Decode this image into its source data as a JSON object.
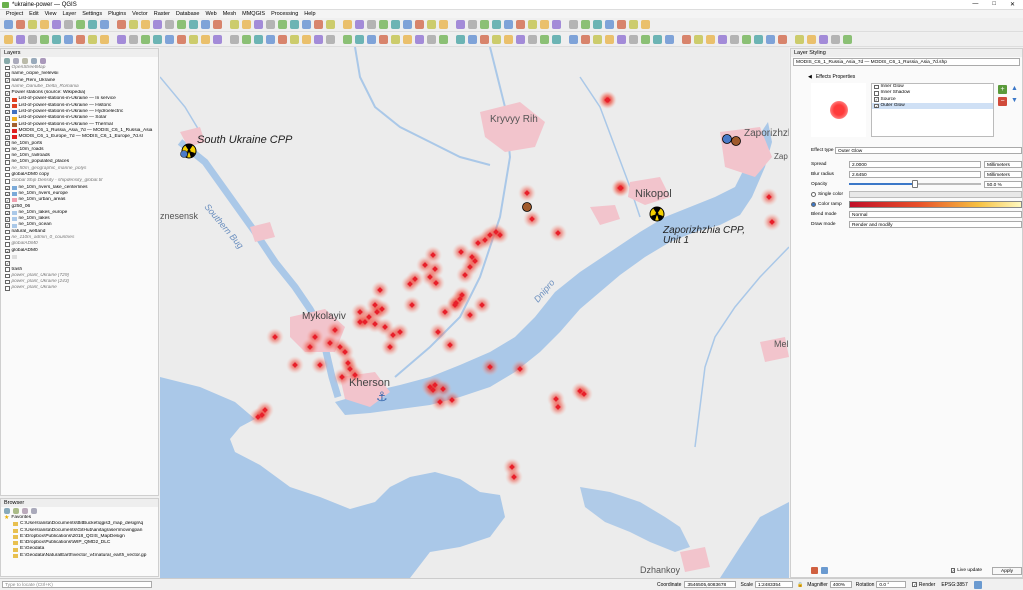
{
  "window": {
    "title": "*ukraine-power — QGIS",
    "controls": [
      "—",
      "□",
      "✕"
    ]
  },
  "menu": [
    "Project",
    "Edit",
    "View",
    "Layer",
    "Settings",
    "Plugins",
    "Vector",
    "Raster",
    "Database",
    "Web",
    "Mesh",
    "MMQGIS",
    "Processing",
    "Help"
  ],
  "layers_panel": {
    "title": "Layers",
    "items": [
      {
        "label": "OpenStreetMap",
        "checked": false,
        "italic": true,
        "swatch": ""
      },
      {
        "label": "name_ocipie_Ivelevsii",
        "checked": true,
        "italic": false,
        "swatch": ""
      },
      {
        "label": "name_Reni_Ukraine",
        "checked": true,
        "italic": false,
        "swatch": ""
      },
      {
        "label": "name_Danube_Delta_Romania",
        "checked": false,
        "italic": true,
        "swatch": ""
      },
      {
        "label": "Power stations (source: Wikipedia)",
        "checked": true,
        "italic": false,
        "swatch": ""
      },
      {
        "label": "List-of-power-stations-in-Ukraine — In service",
        "checked": true,
        "italic": false,
        "swatch": "#e04020"
      },
      {
        "label": "List-of-power-stations-in-Ukraine — Historic",
        "checked": true,
        "italic": false,
        "swatch": "#e04020"
      },
      {
        "label": "List-of-power-stations-in-Ukraine — Hydroelectric",
        "checked": true,
        "italic": false,
        "swatch": "#4070c0"
      },
      {
        "label": "List-of-power-stations-in-Ukraine — Solar",
        "checked": true,
        "italic": false,
        "swatch": "#f0b020"
      },
      {
        "label": "List-of-power-stations-in-Ukraine — Thermal",
        "checked": true,
        "italic": false,
        "swatch": "#a06030"
      },
      {
        "label": "MODIS_C6_1_Russia_Asia_7d — MODIS_C6_1_Russia_Asia",
        "checked": true,
        "italic": false,
        "swatch": "#e02020"
      },
      {
        "label": "MODIS_C6_1_Europe_7d — MODIS_C6_1_Europe_7d.sl",
        "checked": true,
        "italic": false,
        "swatch": "#e02020"
      },
      {
        "label": "ne_10m_ports",
        "checked": true,
        "italic": false,
        "swatch": ""
      },
      {
        "label": "ne_10m_roads",
        "checked": false,
        "italic": false,
        "swatch": ""
      },
      {
        "label": "ne_10m_railroads",
        "checked": false,
        "italic": false,
        "swatch": ""
      },
      {
        "label": "ne_10m_populated_places",
        "checked": false,
        "italic": false,
        "swatch": ""
      },
      {
        "label": "ne_50m_geographic_marine_polys",
        "checked": false,
        "italic": true,
        "swatch": ""
      },
      {
        "label": "globalADM0 copy",
        "checked": false,
        "italic": false,
        "swatch": ""
      },
      {
        "label": "Global Ship Density - shipdensity_global.tif",
        "checked": false,
        "italic": true,
        "swatch": ""
      },
      {
        "label": "ne_10m_rivers_lake_centerlines",
        "checked": true,
        "italic": false,
        "swatch": "#7aa9d8"
      },
      {
        "label": "ne_10m_rivers_europe",
        "checked": true,
        "italic": false,
        "swatch": "#7aa9d8"
      },
      {
        "label": "ne_10m_urban_areas",
        "checked": true,
        "italic": false,
        "swatch": "#f0a0b0"
      },
      {
        "label": "g250_06",
        "checked": true,
        "italic": false,
        "swatch": ""
      },
      {
        "label": "ne_10m_lakes_europe",
        "checked": true,
        "italic": false,
        "swatch": "#aac8e8"
      },
      {
        "label": "ne_10m_lakes",
        "checked": true,
        "italic": false,
        "swatch": "#aac8e8"
      },
      {
        "label": "ne_10m_ocean",
        "checked": true,
        "italic": false,
        "swatch": "#aac8e8"
      },
      {
        "label": "natural_wetland",
        "checked": false,
        "italic": false,
        "swatch": ""
      },
      {
        "label": "ne_110m_admin_0_countries",
        "checked": false,
        "italic": true,
        "swatch": ""
      },
      {
        "label": "globalADM0",
        "checked": false,
        "italic": true,
        "swatch": ""
      },
      {
        "label": "globalADM0",
        "checked": true,
        "italic": false,
        "swatch": ""
      },
      {
        "label": "",
        "checked": false,
        "italic": false,
        "swatch": "#dddddd"
      },
      {
        "label": "",
        "checked": true,
        "italic": false,
        "swatch": ""
      },
      {
        "label": "trash",
        "checked": false,
        "italic": false,
        "swatch": ""
      },
      {
        "label": "power_plant_Ukraine [729]",
        "checked": false,
        "italic": true,
        "swatch": ""
      },
      {
        "label": "power_plant_Ukraine [243]",
        "checked": false,
        "italic": true,
        "swatch": ""
      },
      {
        "label": "power_plant_Ukraine",
        "checked": false,
        "italic": true,
        "swatch": ""
      }
    ]
  },
  "browser_panel": {
    "title": "Browser",
    "favorites_label": "Favorites",
    "items": [
      "C:\\Users\\anita\\Documents\\BitBucket\\qgis3_map_design\\q",
      "C:\\Users\\anita\\Documents\\GitHub\\anitagraser\\movingpan",
      "E:\\Dropbox\\Publications\\2018_QGIS_MapDesign",
      "E:\\Dropbox\\Publications\\WIP_QMD2_DLC",
      "E:\\Geodata",
      "E:\\Geodata\\NaturalEarth\\vector_v4\\natural_earth_vector.gp"
    ]
  },
  "locator": {
    "placeholder": "Type to locate (Ctrl+K)"
  },
  "map": {
    "labels": {
      "south_ukraine": "South Ukraine CPP",
      "kryvyi_rih": "Kryvyy Rih",
      "nikopol": "Nikopol",
      "zaporizhzhia": "Zaporizhzhia",
      "zaporizhzhia_cpp": "Zaporizhzhia CPP,",
      "zaporizhzhia_cpp2": "Unit 1",
      "mykolaiv": "Mykolayiv",
      "kherson": "Kherson",
      "dnipro": "Dnipro",
      "southern_bug": "Southern Bug",
      "voznesensk": "znesensk",
      "dzhankoy": "Dzhankoy",
      "mel": "Mel",
      "zap_cut": "Zap"
    }
  },
  "styling_panel": {
    "title": "Layer Styling",
    "layer_select": "MODIS_C6_1_Russia_Asia_7d — MODIS_C6_1_Russia_Asia_7d.shp",
    "effects_title": "Effects Properties",
    "effects": [
      {
        "label": "Inner Glow",
        "checked": false
      },
      {
        "label": "Inner Shadow",
        "checked": false
      },
      {
        "label": "Source",
        "checked": true
      },
      {
        "label": "Outer Glow",
        "checked": true
      }
    ],
    "effect_type_label": "Effect type",
    "effect_type_value": "Outer Glow",
    "spread_label": "Spread",
    "spread_value": "2.0000",
    "spread_unit": "Millimeters",
    "blur_label": "Blur radius",
    "blur_value": "2.6450",
    "blur_unit": "Millimeters",
    "opacity_label": "Opacity",
    "opacity_value": "50.0 %",
    "opacity_fraction": 0.5,
    "single_color_label": "Single color",
    "color_ramp_label": "Color ramp",
    "blend_label": "Blend mode",
    "blend_value": "Normal",
    "draw_label": "Draw mode",
    "draw_value": "Render and modify",
    "live_update_label": "Live update",
    "apply_label": "Apply"
  },
  "status": {
    "coordinate_label": "Coordinate",
    "coordinate_value": "3546505,6083678",
    "scale_label": "Scale",
    "scale_value": "1:2483354",
    "magnifier_label": "Magnifier",
    "magnifier_value": "400%",
    "rotation_label": "Rotation",
    "rotation_value": "0.0 °",
    "render_label": "Render",
    "crs_label": "EPSG:3857"
  },
  "colors": {
    "water": "#aac8e8",
    "land": "#ececec",
    "urban": "#f2c4cc",
    "fire": "#e8202a",
    "accent": "#3c78c8"
  }
}
